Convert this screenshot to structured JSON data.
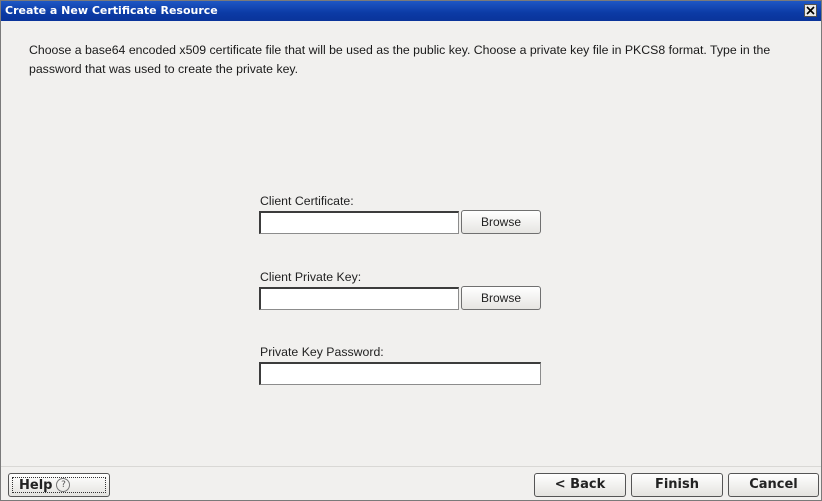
{
  "window": {
    "title": "Create a New Certificate Resource"
  },
  "instructions": "Choose a base64 encoded x509 certificate file that will be used as the public key.  Choose a private key file in PKCS8 format.  Type in the password that was used to create the private key.",
  "form": {
    "client_certificate": {
      "label": "Client Certificate:",
      "value": "",
      "browse_label": "Browse"
    },
    "client_private_key": {
      "label": "Client Private Key:",
      "value": "",
      "browse_label": "Browse"
    },
    "private_key_password": {
      "label": "Private Key Password:",
      "value": ""
    }
  },
  "footer": {
    "help_label": "Help",
    "back_label": "< Back",
    "finish_label": "Finish",
    "cancel_label": "Cancel"
  },
  "icons": {
    "close": "close-icon",
    "help": "help-icon"
  },
  "colors": {
    "titlebar": "#0b3aa5",
    "background": "#f1f0ee"
  }
}
